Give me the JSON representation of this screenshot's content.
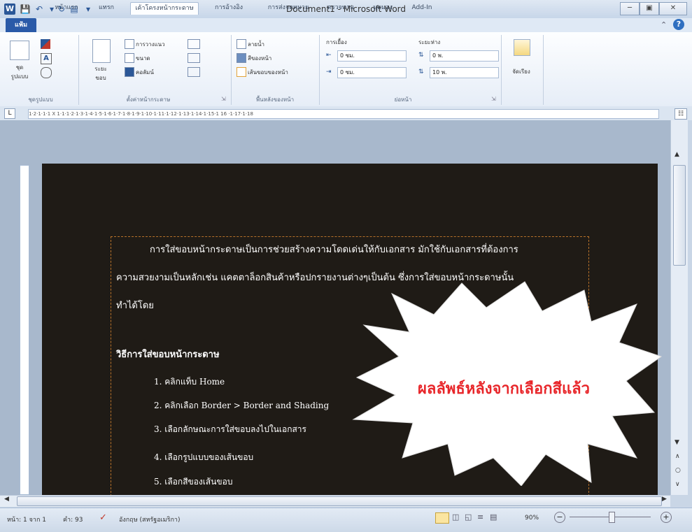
{
  "window": {
    "title": "Document1 - Microsoft Word",
    "app_icon": "W"
  },
  "tabs": [
    "แฟ้ม",
    "หน้าแรก",
    "แทรก",
    "เค้าโครงหน้ากระดาษ",
    "การอ้างอิง",
    "การส่งจดหมาย",
    "ตรวจทาน",
    "มุมมอง",
    "Add-In"
  ],
  "active_tab": "เค้าโครงหน้ากระดาษ",
  "ribbon": {
    "themes_group": {
      "label": "ชุดรูปแบบ",
      "button": "ชุด\nรูปแบบ"
    },
    "page_setup": {
      "label": "ตั้งค่าหน้ากระดาษ",
      "margins": "ระยะ\nขอบ",
      "orientation": "การวางแนว",
      "size": "ขนาด",
      "columns": "คอลัมน์"
    },
    "page_background": {
      "label": "พื้นหลังของหน้า",
      "watermark": "ลายน้ำ",
      "page_color": "สีของหน้า",
      "page_borders": "เส้นขอบของหน้า"
    },
    "paragraph": {
      "label": "ย่อหน้า",
      "indent_title": "การเยื้อง",
      "spacing_title": "ระยะห่าง",
      "indent_left": "0 ซม.",
      "indent_right": "0 ซม.",
      "spacing_before": "0 พ.",
      "spacing_after": "10 พ."
    },
    "arrange": {
      "label": "จัดเรียง"
    }
  },
  "ruler_text": "1·2·1·1·1 X 1·1·1·2·1·3·1·4·1·5·1·6·1·7·1·8·1·9·1·10·1·11·1·12·1·13·1·14·1·15·1 16 ·1·17·1·18",
  "document": {
    "paragraph_1": "การใส่ขอบหน้ากระดาษเป็นการช่วยสร้างความโดดเด่นให้กับเอกสาร มักใช้กับเอกสารที่ต้องการ",
    "paragraph_2": "ความสวยงามเป็นหลักเช่น แคตตาล็อกสินค้าหรือปกรายงานต่างๆเป็นต้น ซึ่งการใส่ขอบหน้ากระดาษนั้น",
    "paragraph_3": "ทำได้โดย",
    "heading": "วิธีการใส่ขอบหน้ากระดาษ",
    "steps": [
      "1. คลิกแท็บ Home",
      "2. คลิกเลือก Border > Border and Shading",
      "3. เลือกลักษณะการใส่ขอบลงไปในเอกสาร",
      "4. เลือกรูปแบบของเส้นขอบ",
      "5. เลือกสีของเส้นขอบ"
    ]
  },
  "callout": {
    "text": "ผลลัพธ์หลังจากเลือกสีแล้ว",
    "text_color": "#e8262a",
    "fill": "#ffffff"
  },
  "status_bar": {
    "page": "หน้า: 1 จาก 1",
    "words": "คำ: 93",
    "language": "อังกฤษ (สหรัฐอเมริกา)",
    "zoom": "90%"
  },
  "colors": {
    "page_background": "#1f1b16",
    "page_border": "#b8722a",
    "file_tab": "#2a5aa8"
  }
}
